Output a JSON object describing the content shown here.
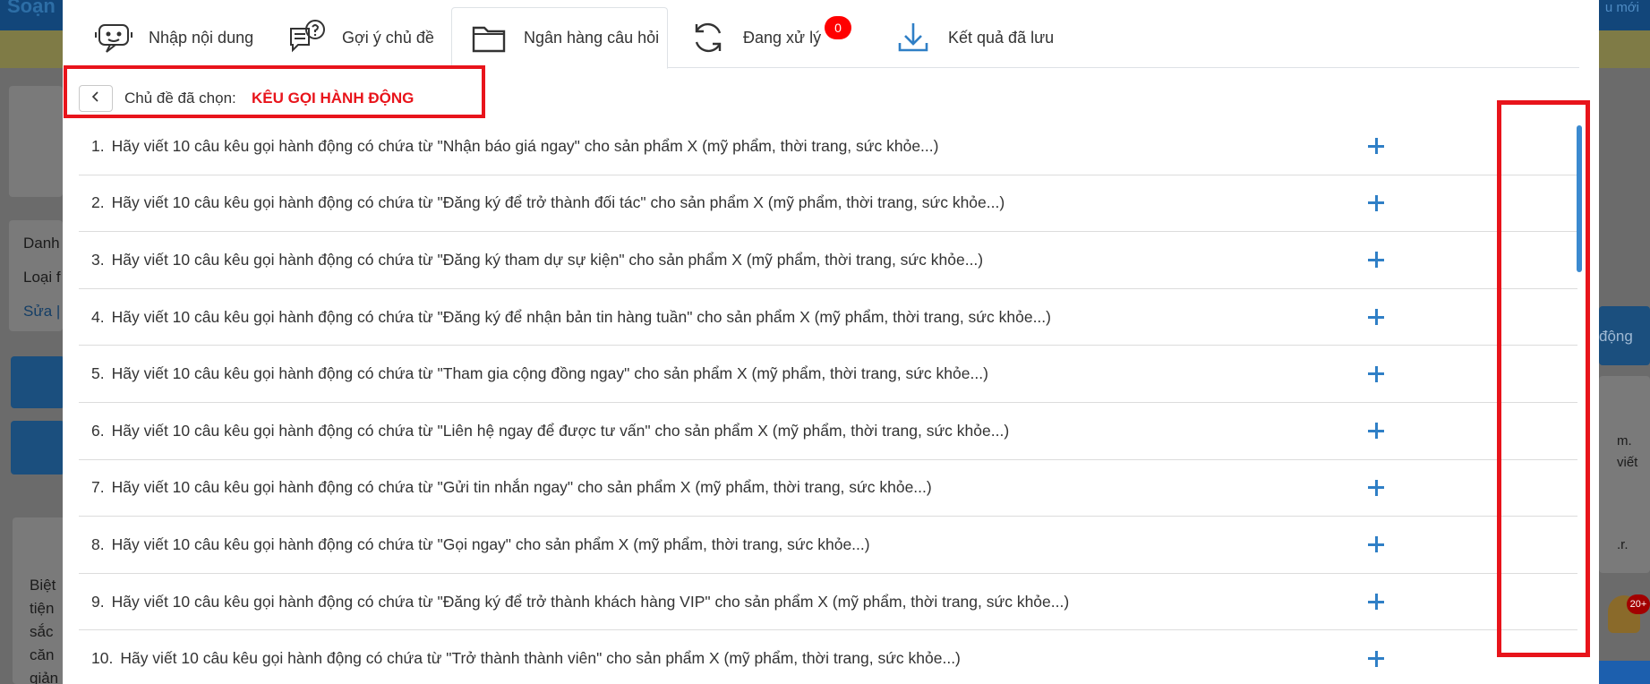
{
  "background": {
    "brand": "Soạn",
    "new_label": "u mới",
    "danh_label": "Danh",
    "loai_label": "Loại f",
    "sua_label": "Sửa |",
    "dong_label": "động",
    "fragment_a": "m.",
    "fragment_b": "viết",
    "fragment_c": ".r.",
    "biet_lines": [
      "Biệt",
      "tiện",
      "sắc",
      "căn",
      "giản"
    ],
    "notification_count": "20+"
  },
  "tabs": [
    {
      "label": "Nhập nội dung",
      "icon": "chatbot-icon"
    },
    {
      "label": "Gợi ý chủ đề",
      "icon": "suggestion-chat-icon"
    },
    {
      "label": "Ngân hàng câu hỏi",
      "icon": "folder-icon",
      "active": true
    },
    {
      "label": "Đang xử lý",
      "icon": "refresh-icon",
      "badge": "0"
    },
    {
      "label": "Kết quả đã lưu",
      "icon": "download-icon"
    }
  ],
  "topic": {
    "label": "Chủ đề đã chọn:",
    "value": "KÊU GỌI HÀNH ĐỘNG"
  },
  "questions": [
    {
      "num": "1.",
      "text": "Hãy viết 10 câu kêu gọi hành động có chứa từ \"Nhận báo giá ngay\" cho sản phẩm X (mỹ phẩm, thời trang, sức khỏe...)"
    },
    {
      "num": "2.",
      "text": "Hãy viết 10 câu kêu gọi hành động có chứa từ \"Đăng ký để trở thành đối tác\" cho sản phẩm X (mỹ phẩm, thời trang, sức khỏe...)"
    },
    {
      "num": "3.",
      "text": "Hãy viết 10 câu kêu gọi hành động có chứa từ \"Đăng ký tham dự sự kiện\" cho sản phẩm X (mỹ phẩm, thời trang, sức khỏe...)"
    },
    {
      "num": "4.",
      "text": "Hãy viết 10 câu kêu gọi hành động có chứa từ \"Đăng ký để nhận bản tin hàng tuần\" cho sản phẩm X (mỹ phẩm, thời trang, sức khỏe...)"
    },
    {
      "num": "5.",
      "text": "Hãy viết 10 câu kêu gọi hành động có chứa từ \"Tham gia cộng đồng ngay\" cho sản phẩm X (mỹ phẩm, thời trang, sức khỏe...)"
    },
    {
      "num": "6.",
      "text": "Hãy viết 10 câu kêu gọi hành động có chứa từ \"Liên hệ ngay để được tư vấn\" cho sản phẩm X (mỹ phẩm, thời trang, sức khỏe...)"
    },
    {
      "num": "7.",
      "text": "Hãy viết 10 câu kêu gọi hành động có chứa từ \"Gửi tin nhắn ngay\" cho sản phẩm X (mỹ phẩm, thời trang, sức khỏe...)"
    },
    {
      "num": "8.",
      "text": "Hãy viết 10 câu kêu gọi hành động có chứa từ \"Gọi ngay\" cho sản phẩm X (mỹ phẩm, thời trang, sức khỏe...)"
    },
    {
      "num": "9.",
      "text": "Hãy viết 10 câu kêu gọi hành động có chứa từ \"Đăng ký để trở thành khách hàng VIP\" cho sản phẩm X (mỹ phẩm, thời trang, sức khỏe...)"
    },
    {
      "num": "10.",
      "text": "Hãy viết 10 câu kêu gọi hành động có chứa từ \"Trở thành thành viên\" cho sản phẩm X (mỹ phẩm, thời trang, sức khỏe...)"
    }
  ],
  "colors": {
    "accent": "#2f7fc6",
    "highlight": "#e8141b",
    "badge": "#ff0000"
  }
}
